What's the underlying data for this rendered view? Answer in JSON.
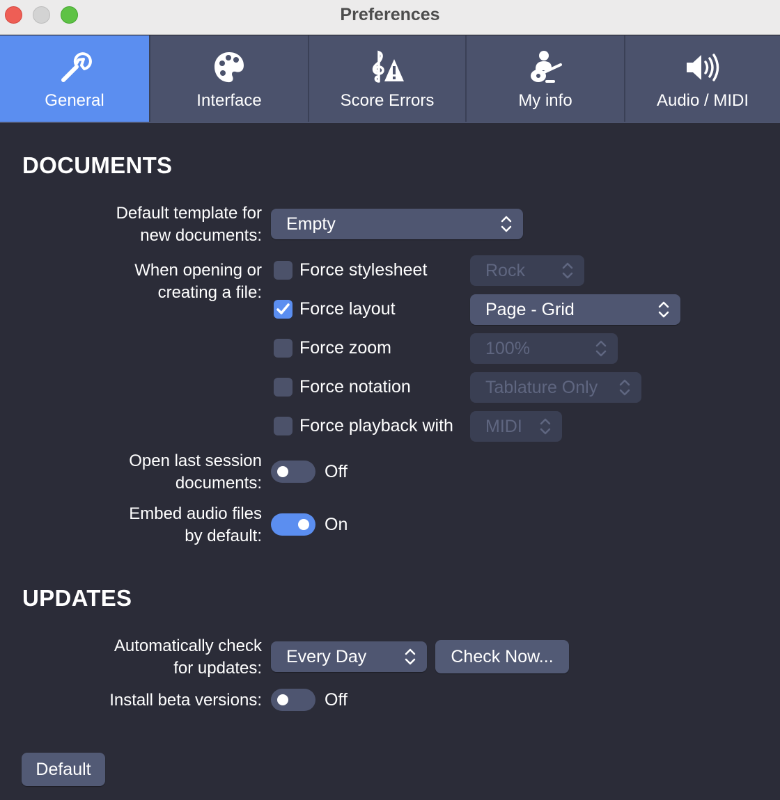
{
  "window": {
    "title": "Preferences"
  },
  "tabs": [
    {
      "label": "General",
      "icon": "wrench-icon",
      "active": true
    },
    {
      "label": "Interface",
      "icon": "palette-icon",
      "active": false
    },
    {
      "label": "Score Errors",
      "icon": "clef-warning-icon",
      "active": false
    },
    {
      "label": "My info",
      "icon": "guitar-player-icon",
      "active": false
    },
    {
      "label": "Audio / MIDI",
      "icon": "speaker-icon",
      "active": false
    }
  ],
  "documents": {
    "title": "DOCUMENTS",
    "template": {
      "label_line1": "Default template for",
      "label_line2": "new documents:",
      "value": "Empty"
    },
    "opening": {
      "label_line1": "When opening or",
      "label_line2": "creating a file:",
      "options": [
        {
          "label": "Force stylesheet",
          "checked": false,
          "value": "Rock",
          "enabled": false
        },
        {
          "label": "Force layout",
          "checked": true,
          "value": "Page - Grid",
          "enabled": true
        },
        {
          "label": "Force zoom",
          "checked": false,
          "value": "100%",
          "enabled": false
        },
        {
          "label": "Force notation",
          "checked": false,
          "value": "Tablature Only",
          "enabled": false
        },
        {
          "label": "Force playback with",
          "checked": false,
          "value": "MIDI",
          "enabled": false
        }
      ]
    },
    "last_session": {
      "label_line1": "Open last session",
      "label_line2": "documents:",
      "state": "Off",
      "on": false
    },
    "embed_audio": {
      "label_line1": "Embed audio files",
      "label_line2": "by default:",
      "state": "On",
      "on": true
    }
  },
  "updates": {
    "title": "UPDATES",
    "auto_check": {
      "label_line1": "Automatically check",
      "label_line2": "for updates:",
      "value": "Every Day",
      "button": "Check Now..."
    },
    "beta": {
      "label": "Install beta versions:",
      "state": "Off",
      "on": false
    }
  },
  "footer": {
    "default_button": "Default"
  },
  "colors": {
    "accent": "#5b8ef0",
    "background": "#2b2c38",
    "tabbar": "#4b526c",
    "control": "#4f5671"
  }
}
